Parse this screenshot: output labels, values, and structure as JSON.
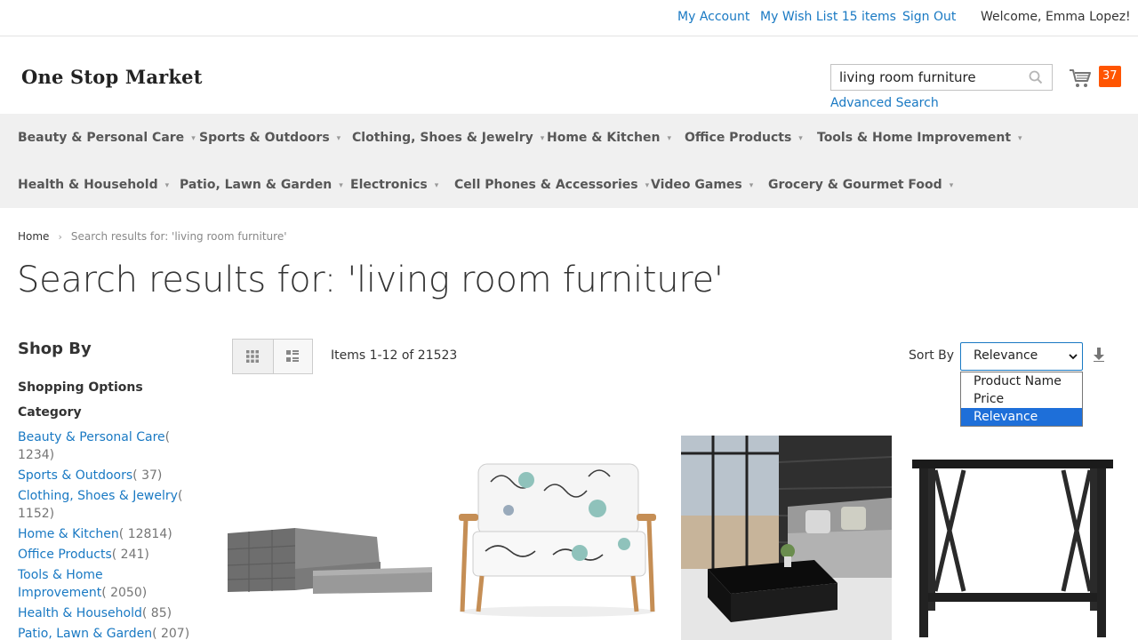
{
  "topbar": {
    "my_account": "My Account",
    "wish_list": "My Wish List 15 items",
    "sign_out": "Sign Out",
    "welcome": "Welcome, Emma Lopez!"
  },
  "header": {
    "logo": "One Stop Market",
    "search_value": "living room furniture",
    "advanced_search": "Advanced Search",
    "cart_count": "37"
  },
  "nav": {
    "items": [
      "Beauty & Personal Care",
      "Sports & Outdoors",
      "Clothing, Shoes & Jewelry",
      "Home & Kitchen",
      "Office Products",
      "Tools & Home Improvement",
      "Health & Household",
      "Patio, Lawn & Garden",
      "Electronics",
      "Cell Phones & Accessories",
      "Video Games",
      "Grocery & Gourmet Food"
    ]
  },
  "breadcrumb": {
    "home": "Home",
    "current": "Search results for: 'living room furniture'"
  },
  "page_title": "Search results for: 'living room furniture'",
  "sidebar": {
    "shop_by": "Shop By",
    "shopping_options": "Shopping Options",
    "category_title": "Category",
    "categories": [
      {
        "name": "Beauty & Personal Care",
        "count": "( 1234)"
      },
      {
        "name": "Sports & Outdoors",
        "count": "( 37)"
      },
      {
        "name": "Clothing, Shoes & Jewelry",
        "count": "( 1152)"
      },
      {
        "name": "Home & Kitchen",
        "count": "( 12814)"
      },
      {
        "name": "Office Products",
        "count": "( 241)"
      },
      {
        "name": "Tools & Home Improvement",
        "count": "( 2050)"
      },
      {
        "name": "Health & Household",
        "count": "( 85)"
      },
      {
        "name": "Patio, Lawn & Garden",
        "count": "( 207)"
      }
    ]
  },
  "toolbar": {
    "amount": "Items 1-12 of 21523",
    "sort_label": "Sort By",
    "sort_selected": "Relevance",
    "sort_options": [
      "Product Name",
      "Price",
      "Relevance"
    ]
  },
  "colors": {
    "link": "#1979c3",
    "badge": "#ff5501",
    "selected_option": "#1e6fd9",
    "nav_bg": "#f0f0f0"
  }
}
